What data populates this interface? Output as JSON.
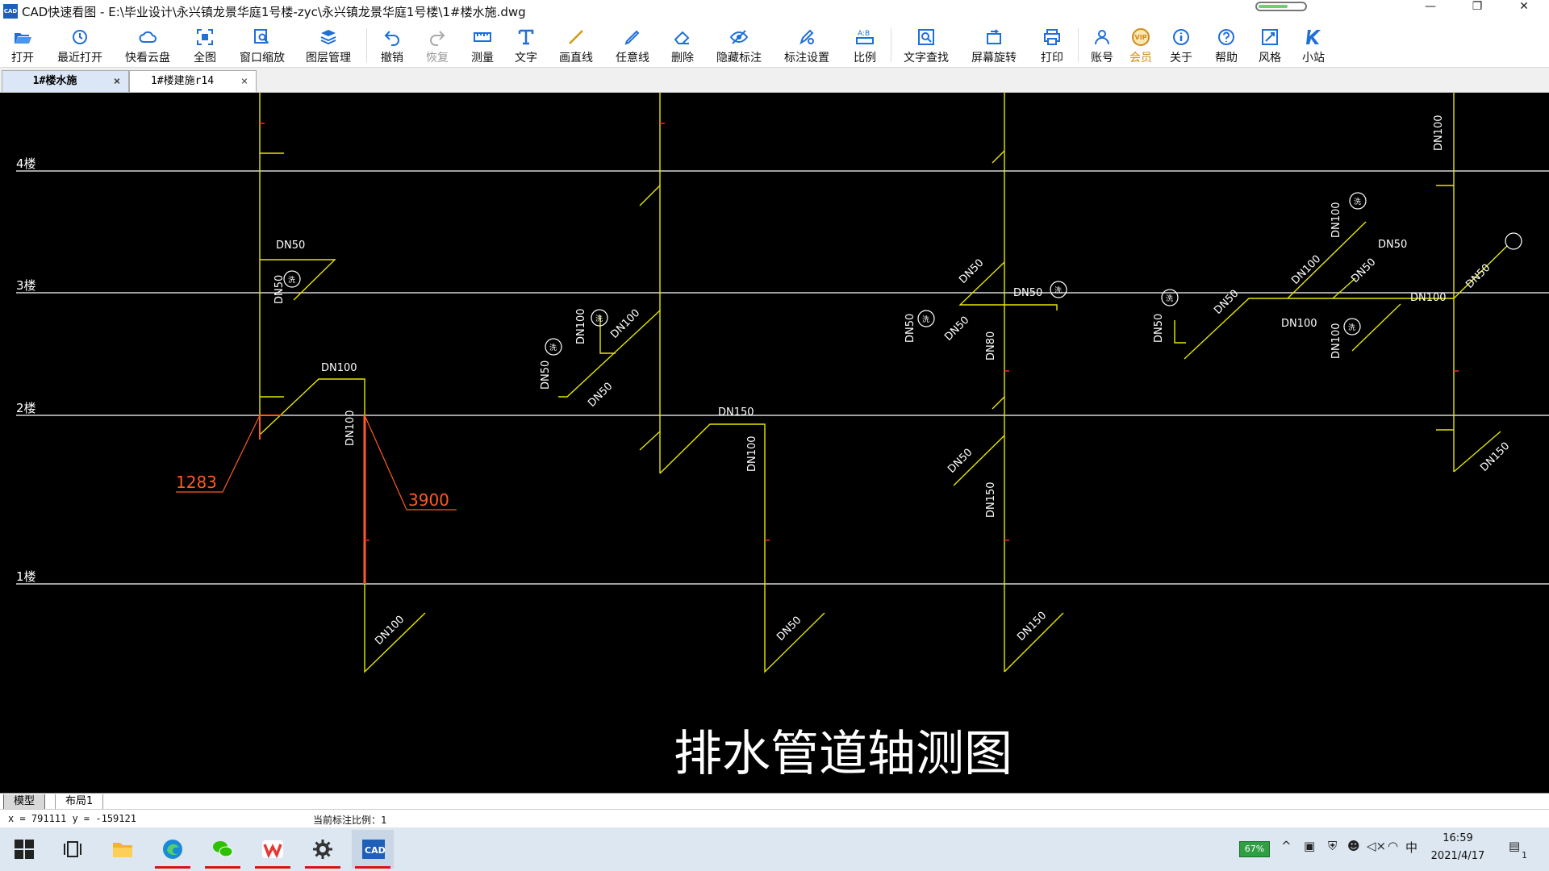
{
  "window": {
    "app_icon": "CAD",
    "title": "CAD快速看图 - E:\\毕业设计\\永兴镇龙景华庭1号楼-zyc\\永兴镇龙景华庭1号楼\\1#楼水施.dwg",
    "minimize": "—",
    "restore": "❐",
    "close": "✕"
  },
  "toolbar": [
    {
      "label": "打开",
      "icon": "folder-open-icon"
    },
    {
      "label": "最近打开",
      "icon": "clock-history-icon"
    },
    {
      "label": "快看云盘",
      "icon": "cloud-icon"
    },
    {
      "label": "全图",
      "icon": "fit-extents-icon"
    },
    {
      "label": "窗口缩放",
      "icon": "zoom-window-icon"
    },
    {
      "label": "图层管理",
      "icon": "layers-icon"
    },
    {
      "label": "撤销",
      "icon": "undo-icon"
    },
    {
      "label": "恢复",
      "icon": "redo-icon",
      "disabled": true
    },
    {
      "label": "测量",
      "icon": "ruler-icon"
    },
    {
      "label": "文字",
      "icon": "text-icon"
    },
    {
      "label": "画直线",
      "icon": "line-icon"
    },
    {
      "label": "任意线",
      "icon": "pen-icon"
    },
    {
      "label": "删除",
      "icon": "eraser-icon"
    },
    {
      "label": "隐藏标注",
      "icon": "eye-hide-icon"
    },
    {
      "label": "标注设置",
      "icon": "settings-annotation-icon"
    },
    {
      "label": "比例",
      "icon": "scale-icon"
    },
    {
      "label": "文字查找",
      "icon": "text-search-icon"
    },
    {
      "label": "屏幕旋转",
      "icon": "rotate-screen-icon"
    },
    {
      "label": "打印",
      "icon": "printer-icon"
    },
    {
      "label": "账号",
      "icon": "user-icon"
    },
    {
      "label": "会员",
      "icon": "vip-icon",
      "vip": true
    },
    {
      "label": "关于",
      "icon": "info-icon"
    },
    {
      "label": "帮助",
      "icon": "help-icon"
    },
    {
      "label": "风格",
      "icon": "style-icon"
    },
    {
      "label": "小站",
      "icon": "station-icon"
    }
  ],
  "tabs": [
    {
      "name": "1#楼水施",
      "active": true
    },
    {
      "name": "1#楼建施r14",
      "active": false
    }
  ],
  "tab_close": "×",
  "drawing": {
    "title": "排水管道轴测图",
    "floors": [
      "4楼",
      "3楼",
      "2楼",
      "1楼"
    ],
    "pipe_labels": {
      "a1": "DN50",
      "a2": "DN50",
      "a3": "DN100",
      "a4": "DN100",
      "a5": "DN100",
      "b1": "DN100",
      "b2": "DN100",
      "b3": "DN50",
      "b4": "DN50",
      "b5": "DN150",
      "b6": "DN100",
      "b7": "DN50",
      "c1": "DN50",
      "c2": "DN50",
      "c3": "DN50",
      "c4": "DN50",
      "c5": "DN80",
      "c6": "DN50",
      "c7": "DN150",
      "c8": "DN150",
      "d1": "DN100",
      "d2": "DN100",
      "d3": "DN50",
      "d4": "DN50",
      "d5": "DN50",
      "d6": "DN100",
      "d7": "DN100",
      "d8": "DN100",
      "d9": "DN100",
      "d10": "DN50",
      "d11": "DN50",
      "d12": "DN150"
    },
    "dimensions": [
      "1283",
      "3900"
    ],
    "fixture_tags": [
      "洗",
      "洗",
      "洗",
      "洗",
      "洗",
      "洗",
      "洗",
      "洗"
    ]
  },
  "layout_tabs": [
    "模型",
    "布局1"
  ],
  "status": {
    "coords": "x = 791111 y = -159121",
    "scale": "当前标注比例：1"
  },
  "taskbar": {
    "battery": "67%",
    "input_lang": "中",
    "time": "16:59",
    "date": "2021/4/17",
    "notifications": "1"
  },
  "colors": {
    "canvas": "#000000",
    "pipe": "#e6e600",
    "floor_line": "#ffffff",
    "dimension": "#ff5a1f",
    "accent_blue": "#1e6fd9"
  }
}
